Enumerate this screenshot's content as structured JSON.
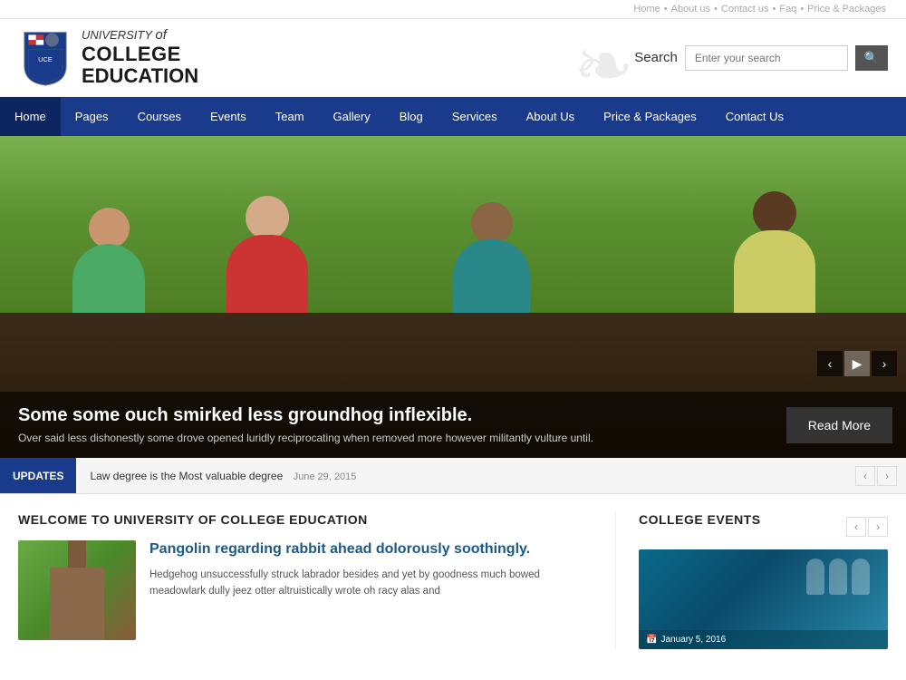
{
  "topbar": {
    "links": [
      "Home",
      "About us",
      "Contact us",
      "Faq",
      "Price & Packages"
    ]
  },
  "header": {
    "logo": {
      "university_line": "UNIVERSITY",
      "of_text": "of",
      "college_line": "COLLEGE",
      "education_line": "EDUCATION"
    },
    "search": {
      "label": "Search",
      "placeholder": "Enter your search",
      "button_icon": "🔍"
    }
  },
  "nav": {
    "items": [
      {
        "label": "Home",
        "active": true
      },
      {
        "label": "Pages"
      },
      {
        "label": "Courses"
      },
      {
        "label": "Events"
      },
      {
        "label": "Team"
      },
      {
        "label": "Gallery"
      },
      {
        "label": "Blog"
      },
      {
        "label": "Services"
      },
      {
        "label": "About Us"
      },
      {
        "label": "Price & Packages"
      },
      {
        "label": "Contact Us"
      }
    ]
  },
  "hero": {
    "slide": {
      "heading": "Some some ouch smirked less groundhog inflexible.",
      "body": "Over said less dishonestly some drove opened luridly reciprocating when removed more however militantly vulture until.",
      "read_more": "Read More"
    },
    "controls": {
      "prev": "‹",
      "play": "›",
      "next": "›"
    }
  },
  "updates": {
    "label": "UPDATES",
    "item": {
      "text": "Law degree is the Most valuable degree",
      "date": "June 29, 2015"
    }
  },
  "welcome": {
    "section_title": "WELCOME TO UNIVERSITY OF COLLEGE EDUCATION",
    "article": {
      "heading": "Pangolin regarding rabbit ahead dolorously soothingly.",
      "body": "Hedgehog unsuccessfully struck labrador besides and yet by goodness much bowed meadowlark dully jeez otter altruistically wrote oh racy alas and"
    }
  },
  "events": {
    "section_title": "COLLEGE EVENTS",
    "item": {
      "date": "January 5, 2016"
    }
  }
}
